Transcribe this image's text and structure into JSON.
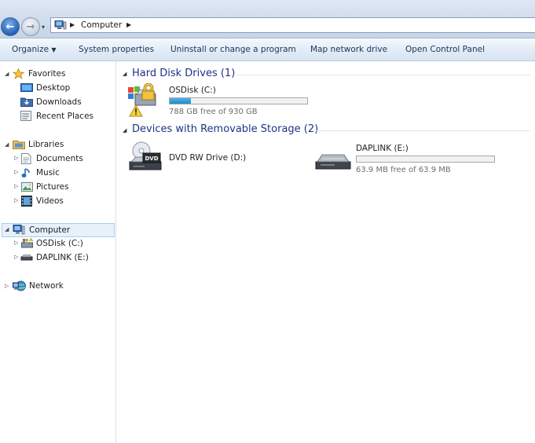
{
  "address": {
    "location": "Computer"
  },
  "toolbar": {
    "organize": "Organize",
    "system_properties": "System properties",
    "uninstall": "Uninstall or change a program",
    "map_drive": "Map network drive",
    "control_panel": "Open Control Panel"
  },
  "nav": {
    "favorites": "Favorites",
    "desktop": "Desktop",
    "downloads": "Downloads",
    "recent": "Recent Places",
    "libraries": "Libraries",
    "documents": "Documents",
    "music": "Music",
    "pictures": "Pictures",
    "videos": "Videos",
    "computer": "Computer",
    "osdisk": "OSDisk (C:)",
    "daplink": "DAPLINK (E:)",
    "network": "Network"
  },
  "groups": {
    "hard_disks": "Hard Disk Drives (1)",
    "removable": "Devices with Removable Storage (2)"
  },
  "drives": {
    "c": {
      "name": "OSDisk (C:)",
      "free": "788 GB free of 930 GB",
      "used_fraction": 0.153
    },
    "d": {
      "name": "DVD RW Drive (D:)"
    },
    "e": {
      "name": "DAPLINK (E:)",
      "free": "63.9 MB free of 63.9 MB",
      "used_fraction": 0.0
    }
  },
  "icons": {
    "dvd_label": "DVD"
  },
  "colors": {
    "group_title": "#1e3287",
    "selection": "#e5f1fb",
    "bar_fill": "#1e8ad0"
  }
}
